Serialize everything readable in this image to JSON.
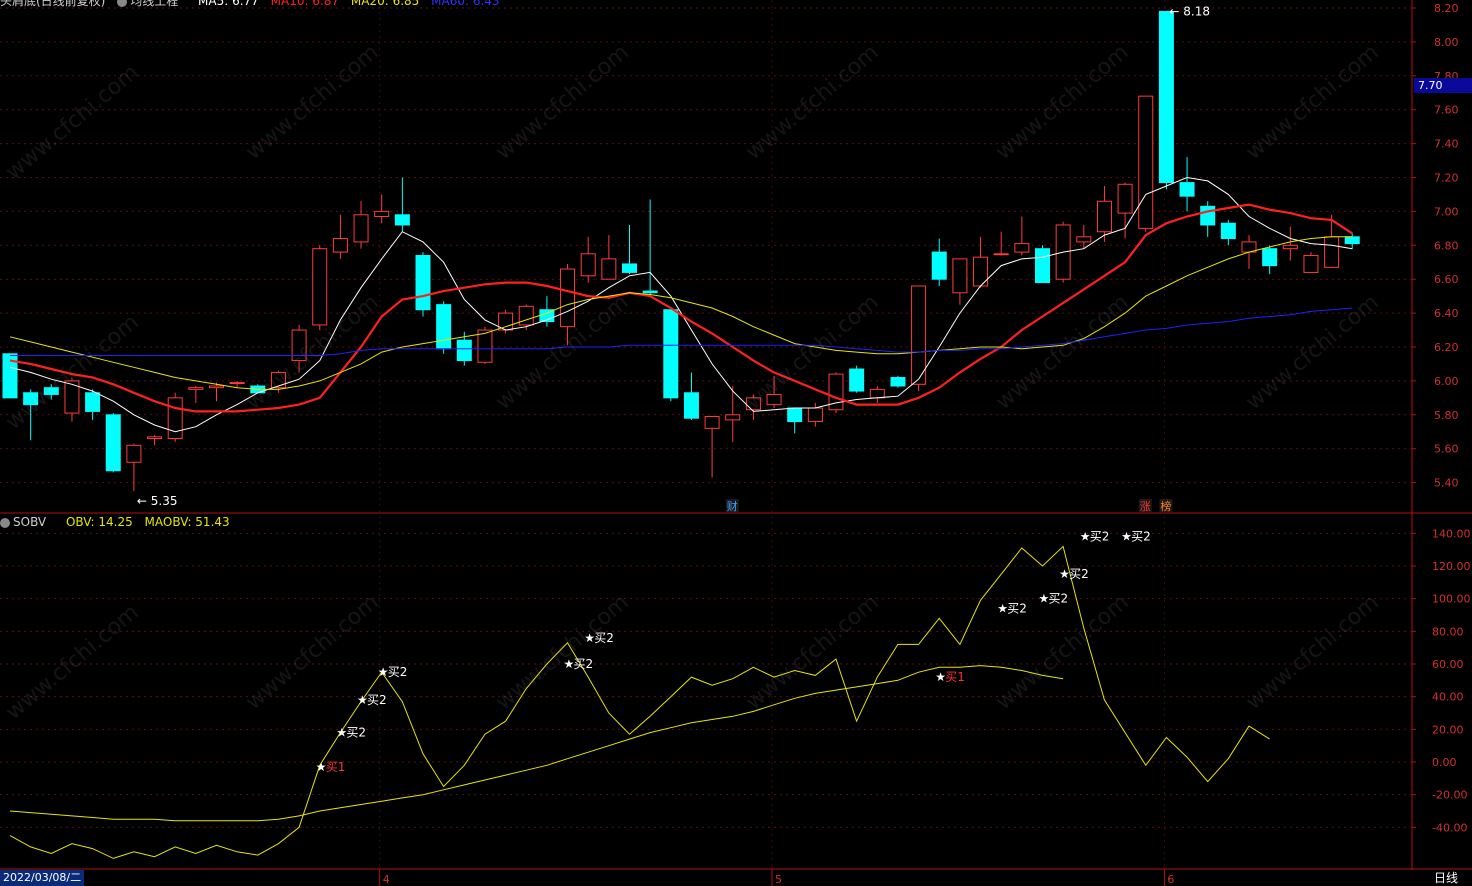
{
  "header": {
    "title": "头肩底(日线前复权)",
    "main_indicator": "均线工程",
    "ma5": "MA5: 6.77",
    "ma10": "MA10: 6.87",
    "ma20": "MA20: 6.85",
    "ma60": "MA60: 6.43"
  },
  "sub_header": {
    "name": "SOBV",
    "obv": "OBV: 14.25",
    "maobv": "MAOBV: 51.43"
  },
  "current_price_tag": "7.70",
  "date_label": "2022/03/08/二",
  "period_label": "日线",
  "watermark": "www.cfchi.com",
  "colors": {
    "up": "#ff3b3b",
    "down": "#00ffff",
    "ma5": "#ffffff",
    "ma10": "#ff2020",
    "ma20": "#e6e600",
    "ma60": "#2020ff",
    "obv": "#e6e600",
    "axis": "#b01010"
  },
  "chart_data": [
    {
      "type": "candlestick",
      "title": "",
      "ylim": [
        5.3,
        8.25
      ],
      "y_ticks": [
        "8.20",
        "8.00",
        "7.80",
        "7.60",
        "7.40",
        "7.20",
        "7.00",
        "6.80",
        "6.60",
        "6.40",
        "6.20",
        "6.00",
        "5.80",
        "5.60",
        "5.40"
      ],
      "x_month_labels": [
        "4",
        "5",
        "6"
      ],
      "x_month_label_index": [
        18,
        37,
        56
      ],
      "candles": [
        {
          "o": 6.16,
          "h": 6.16,
          "l": 5.9,
          "c": 5.9
        },
        {
          "o": 5.93,
          "h": 5.95,
          "l": 5.65,
          "c": 5.86
        },
        {
          "o": 5.96,
          "h": 5.98,
          "l": 5.89,
          "c": 5.92
        },
        {
          "o": 5.81,
          "h": 6.02,
          "l": 5.76,
          "c": 6.0
        },
        {
          "o": 5.93,
          "h": 5.95,
          "l": 5.77,
          "c": 5.82
        },
        {
          "o": 5.8,
          "h": 5.81,
          "l": 5.46,
          "c": 5.47
        },
        {
          "o": 5.52,
          "h": 5.63,
          "l": 5.35,
          "c": 5.62
        },
        {
          "o": 5.66,
          "h": 5.68,
          "l": 5.62,
          "c": 5.67
        },
        {
          "o": 5.66,
          "h": 5.93,
          "l": 5.64,
          "c": 5.9
        },
        {
          "o": 5.95,
          "h": 5.97,
          "l": 5.87,
          "c": 5.96
        },
        {
          "o": 5.96,
          "h": 5.99,
          "l": 5.88,
          "c": 5.97
        },
        {
          "o": 5.99,
          "h": 6.0,
          "l": 5.96,
          "c": 5.99
        },
        {
          "o": 5.97,
          "h": 5.98,
          "l": 5.93,
          "c": 5.93
        },
        {
          "o": 5.96,
          "h": 6.06,
          "l": 5.93,
          "c": 6.05
        },
        {
          "o": 6.12,
          "h": 6.33,
          "l": 6.05,
          "c": 6.3
        },
        {
          "o": 6.33,
          "h": 6.8,
          "l": 6.3,
          "c": 6.78
        },
        {
          "o": 6.76,
          "h": 6.98,
          "l": 6.72,
          "c": 6.84
        },
        {
          "o": 6.82,
          "h": 7.06,
          "l": 6.78,
          "c": 6.98
        },
        {
          "o": 6.97,
          "h": 7.1,
          "l": 6.93,
          "c": 7.0
        },
        {
          "o": 6.98,
          "h": 7.2,
          "l": 6.88,
          "c": 6.92
        },
        {
          "o": 6.74,
          "h": 6.76,
          "l": 6.38,
          "c": 6.42
        },
        {
          "o": 6.45,
          "h": 6.47,
          "l": 6.16,
          "c": 6.19
        },
        {
          "o": 6.24,
          "h": 6.29,
          "l": 6.09,
          "c": 6.12
        },
        {
          "o": 6.11,
          "h": 6.32,
          "l": 6.1,
          "c": 6.3
        },
        {
          "o": 6.3,
          "h": 6.42,
          "l": 6.28,
          "c": 6.4
        },
        {
          "o": 6.33,
          "h": 6.45,
          "l": 6.3,
          "c": 6.44
        },
        {
          "o": 6.42,
          "h": 6.5,
          "l": 6.32,
          "c": 6.35
        },
        {
          "o": 6.32,
          "h": 6.69,
          "l": 6.21,
          "c": 6.66
        },
        {
          "o": 6.62,
          "h": 6.85,
          "l": 6.58,
          "c": 6.75
        },
        {
          "o": 6.6,
          "h": 6.86,
          "l": 6.6,
          "c": 6.72
        },
        {
          "o": 6.69,
          "h": 6.92,
          "l": 6.63,
          "c": 6.64
        },
        {
          "o": 6.53,
          "h": 7.07,
          "l": 6.5,
          "c": 6.52
        },
        {
          "o": 6.42,
          "h": 6.42,
          "l": 5.88,
          "c": 5.9
        },
        {
          "o": 5.93,
          "h": 6.05,
          "l": 5.77,
          "c": 5.78
        },
        {
          "o": 5.72,
          "h": 5.79,
          "l": 5.43,
          "c": 5.79
        },
        {
          "o": 5.77,
          "h": 5.97,
          "l": 5.64,
          "c": 5.8
        },
        {
          "o": 5.83,
          "h": 5.92,
          "l": 5.77,
          "c": 5.9
        },
        {
          "o": 5.86,
          "h": 6.03,
          "l": 5.84,
          "c": 5.92
        },
        {
          "o": 5.84,
          "h": 5.84,
          "l": 5.69,
          "c": 5.76
        },
        {
          "o": 5.76,
          "h": 5.87,
          "l": 5.73,
          "c": 5.84
        },
        {
          "o": 5.83,
          "h": 6.05,
          "l": 5.81,
          "c": 6.04
        },
        {
          "o": 6.07,
          "h": 6.09,
          "l": 5.93,
          "c": 5.94
        },
        {
          "o": 5.9,
          "h": 5.97,
          "l": 5.87,
          "c": 5.95
        },
        {
          "o": 6.02,
          "h": 6.03,
          "l": 5.96,
          "c": 5.97
        },
        {
          "o": 5.98,
          "h": 6.56,
          "l": 5.94,
          "c": 6.56
        },
        {
          "o": 6.76,
          "h": 6.84,
          "l": 6.56,
          "c": 6.6
        },
        {
          "o": 6.52,
          "h": 6.72,
          "l": 6.45,
          "c": 6.72
        },
        {
          "o": 6.56,
          "h": 6.85,
          "l": 6.55,
          "c": 6.73
        },
        {
          "o": 6.75,
          "h": 6.88,
          "l": 6.74,
          "c": 6.75
        },
        {
          "o": 6.76,
          "h": 6.97,
          "l": 6.74,
          "c": 6.81
        },
        {
          "o": 6.78,
          "h": 6.8,
          "l": 6.58,
          "c": 6.58
        },
        {
          "o": 6.6,
          "h": 6.94,
          "l": 6.58,
          "c": 6.92
        },
        {
          "o": 6.82,
          "h": 6.92,
          "l": 6.78,
          "c": 6.85
        },
        {
          "o": 6.88,
          "h": 7.15,
          "l": 6.82,
          "c": 7.06
        },
        {
          "o": 6.99,
          "h": 7.17,
          "l": 6.84,
          "c": 7.16
        },
        {
          "o": 6.9,
          "h": 7.68,
          "l": 6.88,
          "c": 7.68
        },
        {
          "o": 8.18,
          "h": 8.18,
          "l": 7.13,
          "c": 7.17
        },
        {
          "o": 7.17,
          "h": 7.32,
          "l": 7.0,
          "c": 7.09
        },
        {
          "o": 7.03,
          "h": 7.06,
          "l": 6.85,
          "c": 6.92
        },
        {
          "o": 6.93,
          "h": 6.95,
          "l": 6.8,
          "c": 6.84
        },
        {
          "o": 6.76,
          "h": 6.86,
          "l": 6.66,
          "c": 6.82
        },
        {
          "o": 6.78,
          "h": 6.8,
          "l": 6.63,
          "c": 6.68
        },
        {
          "o": 6.78,
          "h": 6.91,
          "l": 6.71,
          "c": 6.8
        },
        {
          "o": 6.64,
          "h": 6.76,
          "l": 6.64,
          "c": 6.74
        },
        {
          "o": 6.67,
          "h": 6.98,
          "l": 6.67,
          "c": 6.85
        },
        {
          "o": 6.85,
          "h": 6.87,
          "l": 6.78,
          "c": 6.81
        }
      ],
      "ma_series": [
        {
          "name": "MA5",
          "values": [
            6.08,
            6.05,
            6.01,
            5.98,
            5.94,
            5.88,
            5.8,
            5.74,
            5.7,
            5.73,
            5.8,
            5.86,
            5.93,
            5.97,
            6.01,
            6.12,
            6.36,
            6.55,
            6.72,
            6.88,
            6.82,
            6.7,
            6.48,
            6.36,
            6.3,
            6.32,
            6.36,
            6.41,
            6.47,
            6.55,
            6.62,
            6.64,
            6.5,
            6.3,
            6.1,
            5.94,
            5.82,
            5.83,
            5.84,
            5.84,
            5.87,
            5.89,
            5.9,
            5.91,
            6.01,
            6.2,
            6.4,
            6.56,
            6.68,
            6.72,
            6.73,
            6.76,
            6.78,
            6.86,
            6.9,
            7.1,
            7.15,
            7.2,
            7.18,
            7.1,
            6.97,
            6.9,
            6.84,
            6.81,
            6.8,
            6.78
          ]
        },
        {
          "name": "MA10",
          "values": [
            6.12,
            6.1,
            6.07,
            6.04,
            6.02,
            5.98,
            5.93,
            5.88,
            5.84,
            5.82,
            5.82,
            5.82,
            5.83,
            5.84,
            5.86,
            5.9,
            6.05,
            6.2,
            6.38,
            6.48,
            6.5,
            6.53,
            6.55,
            6.57,
            6.58,
            6.58,
            6.56,
            6.53,
            6.5,
            6.49,
            6.52,
            6.5,
            6.43,
            6.35,
            6.28,
            6.2,
            6.12,
            6.05,
            6.0,
            5.95,
            5.9,
            5.86,
            5.86,
            5.86,
            5.9,
            5.96,
            6.05,
            6.13,
            6.2,
            6.3,
            6.38,
            6.46,
            6.54,
            6.62,
            6.7,
            6.86,
            6.93,
            6.97,
            7.0,
            7.02,
            7.04,
            7.01,
            6.99,
            6.96,
            6.95,
            6.87
          ]
        },
        {
          "name": "MA20",
          "values": [
            6.26,
            6.23,
            6.2,
            6.17,
            6.14,
            6.11,
            6.08,
            6.05,
            6.02,
            6.0,
            5.98,
            5.96,
            5.95,
            5.95,
            5.97,
            6.0,
            6.05,
            6.1,
            6.17,
            6.2,
            6.22,
            6.24,
            6.26,
            6.28,
            6.32,
            6.36,
            6.4,
            6.45,
            6.48,
            6.5,
            6.52,
            6.51,
            6.49,
            6.46,
            6.43,
            6.38,
            6.32,
            6.27,
            6.22,
            6.2,
            6.18,
            6.17,
            6.16,
            6.16,
            6.17,
            6.18,
            6.19,
            6.2,
            6.2,
            6.19,
            6.2,
            6.21,
            6.25,
            6.32,
            6.4,
            6.5,
            6.56,
            6.62,
            6.67,
            6.72,
            6.76,
            6.79,
            6.82,
            6.84,
            6.85,
            6.85
          ]
        },
        {
          "name": "MA60",
          "values": [
            6.15,
            6.15,
            6.15,
            6.15,
            6.15,
            6.15,
            6.15,
            6.15,
            6.15,
            6.15,
            6.15,
            6.15,
            6.15,
            6.15,
            6.15,
            6.15,
            6.16,
            6.18,
            6.19,
            6.19,
            6.19,
            6.19,
            6.19,
            6.19,
            6.19,
            6.19,
            6.19,
            6.2,
            6.2,
            6.2,
            6.21,
            6.21,
            6.21,
            6.21,
            6.21,
            6.21,
            6.21,
            6.21,
            6.21,
            6.21,
            6.2,
            6.19,
            6.18,
            6.17,
            6.17,
            6.18,
            6.18,
            6.19,
            6.19,
            6.2,
            6.21,
            6.22,
            6.24,
            6.26,
            6.28,
            6.3,
            6.31,
            6.33,
            6.34,
            6.35,
            6.37,
            6.38,
            6.39,
            6.41,
            6.42,
            6.43
          ]
        }
      ],
      "annotations": [
        {
          "index": 6,
          "price": 5.35,
          "text": "← 5.35"
        },
        {
          "index": 56,
          "price": 8.18,
          "text": "← 8.18"
        }
      ],
      "event_markers": [
        {
          "index": 35,
          "text": "财",
          "color": "#40a0ff"
        },
        {
          "index": 55,
          "text": "涨",
          "color": "#ff3030"
        },
        {
          "index": 56,
          "text": "榜",
          "color": "#ff8020"
        }
      ]
    },
    {
      "type": "line",
      "title": "SOBV",
      "ylim": [
        -48,
        145
      ],
      "y_ticks": [
        "140.00",
        "120.00",
        "100.00",
        "80.00",
        "60.00",
        "40.00",
        "20.00",
        "0.00",
        "-20.00",
        "-40.00"
      ],
      "series": [
        {
          "name": "OBV",
          "values": [
            -45,
            -52,
            -56,
            -50,
            -53,
            -59,
            -55,
            -58,
            -52,
            -56,
            -51,
            -55,
            -57,
            -50,
            -40,
            -2,
            18,
            37,
            55,
            37,
            5,
            -15,
            -2,
            17,
            25,
            45,
            60,
            73,
            52,
            30,
            17,
            28,
            40,
            52,
            47,
            51,
            58,
            52,
            56,
            53,
            63,
            25,
            52,
            72,
            72,
            88,
            72,
            99,
            115,
            131,
            120,
            132,
            82,
            38,
            18,
            -2,
            15,
            3,
            -12,
            2,
            22,
            14
          ]
        },
        {
          "name": "MAOBV",
          "values": [
            -30,
            -31,
            -32,
            -33,
            -34,
            -35,
            -35,
            -35,
            -36,
            -36,
            -36,
            -36,
            -36,
            -35,
            -33,
            -30,
            -28,
            -26,
            -24,
            -22,
            -20,
            -17,
            -14,
            -11,
            -8,
            -5,
            -2,
            2,
            6,
            10,
            14,
            18,
            21,
            24,
            26,
            28,
            31,
            35,
            39,
            42,
            44,
            46,
            48,
            50,
            55,
            58,
            58,
            59,
            58,
            56,
            53,
            51
          ]
        }
      ],
      "signals": [
        {
          "index": 15,
          "value": -3,
          "text": "买1",
          "color": "#ff3030"
        },
        {
          "index": 16,
          "value": 18,
          "text": "买2",
          "color": "#ffffff"
        },
        {
          "index": 17,
          "value": 38,
          "text": "买2",
          "color": "#ffffff"
        },
        {
          "index": 18,
          "value": 55,
          "text": "买2",
          "color": "#ffffff"
        },
        {
          "index": 27,
          "value": 60,
          "text": "买2",
          "color": "#ffffff"
        },
        {
          "index": 28,
          "value": 76,
          "text": "买2",
          "color": "#ffffff"
        },
        {
          "index": 45,
          "value": 52,
          "text": "买1",
          "color": "#ff3030"
        },
        {
          "index": 48,
          "value": 94,
          "text": "买2",
          "color": "#ffffff"
        },
        {
          "index": 50,
          "value": 100,
          "text": "买2",
          "color": "#ffffff"
        },
        {
          "index": 51,
          "value": 115,
          "text": "买2",
          "color": "#ffffff"
        },
        {
          "index": 52,
          "value": 138,
          "text": "买2",
          "color": "#ffffff"
        },
        {
          "index": 54,
          "value": 138,
          "text": "买2",
          "color": "#ffffff"
        }
      ]
    }
  ]
}
